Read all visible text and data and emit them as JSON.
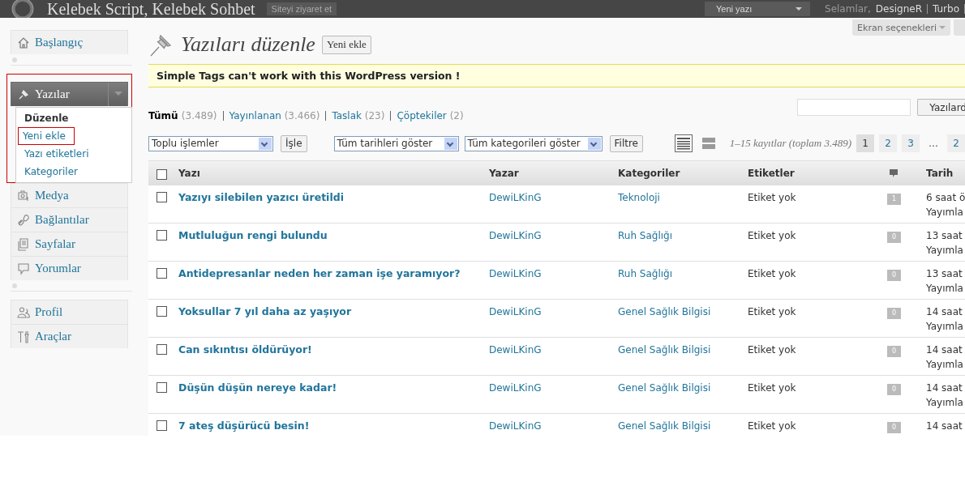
{
  "topbar": {
    "site_title": "Kelebek Script, Kelebek Sohbet",
    "visit_button": "Siteyi ziyaret et",
    "new_post_dropdown": "Yeni yazı",
    "greeting": "Selamlar,",
    "user": "DesigneR",
    "links": [
      "Turbo"
    ]
  },
  "screen_tabs": [
    "Ekran seçenekleri"
  ],
  "sidebar": {
    "groups": [
      [
        {
          "label": "Başlangıç",
          "kind": "home",
          "expanded": false,
          "outlined": false
        }
      ],
      [
        {
          "label": "Yazılar",
          "kind": "pin",
          "expanded": true,
          "outlined": true,
          "submenu": [
            {
              "label": "Düzenle",
              "selected": true,
              "outlined": false
            },
            {
              "label": "Yeni ekle",
              "selected": false,
              "outlined": true
            },
            {
              "label": "Yazı etiketleri",
              "selected": false,
              "outlined": false
            },
            {
              "label": "Kategoriler",
              "selected": false,
              "outlined": false
            }
          ]
        },
        {
          "label": "Medya",
          "kind": "media",
          "expanded": false,
          "outlined": false
        },
        {
          "label": "Bağlantılar",
          "kind": "link",
          "expanded": false,
          "outlined": false
        },
        {
          "label": "Sayfalar",
          "kind": "pages",
          "expanded": false,
          "outlined": false
        },
        {
          "label": "Yorumlar",
          "kind": "comments",
          "expanded": false,
          "outlined": false
        }
      ],
      [
        {
          "label": "Profil",
          "kind": "users",
          "expanded": false,
          "outlined": false
        },
        {
          "label": "Araçlar",
          "kind": "tools",
          "expanded": false,
          "outlined": false
        }
      ]
    ]
  },
  "page_title": "Yazıları düzenle",
  "add_button": "Yeni ekle",
  "notice": "Simple Tags can't work with this WordPress version !",
  "status_filters": [
    {
      "label": "Tümü",
      "count": "(3.489)",
      "selected": true
    },
    {
      "label": "Yayınlanan",
      "count": "(3.466)",
      "selected": false
    },
    {
      "label": "Taslak",
      "count": "(23)",
      "selected": false
    },
    {
      "label": "Çöptekiler",
      "count": "(2)",
      "selected": false
    }
  ],
  "search": {
    "button": "Yazılard"
  },
  "bulk_actions": {
    "select": "Toplu işlemler",
    "apply": "İşle"
  },
  "filters": {
    "dates": "Tüm tarihleri göster",
    "categories": "Tüm kategorileri göster",
    "button": "Filtre"
  },
  "view_modes": [
    {
      "kind": "list",
      "selected": true
    },
    {
      "kind": "excerpt",
      "selected": false
    }
  ],
  "displaying": "1–15 kayıtlar (toplam 3.489)",
  "pages": {
    "gap": "…",
    "items": [
      {
        "label": "1",
        "selected": true
      },
      {
        "label": "2",
        "selected": false
      },
      {
        "label": "3",
        "selected": false
      },
      {
        "label": "2",
        "selected": false
      }
    ]
  },
  "table": {
    "select_all_checked": false,
    "columns": [
      "Yazı",
      "Yazar",
      "Kategoriler",
      "Etiketler",
      "Tarih"
    ],
    "rows": [
      {
        "checked": false,
        "title": "Yazıyı silebilen yazıcı üretildi",
        "author": "DewiLKinG",
        "category": "Teknoloji",
        "tags": "Etiket yok",
        "comments": "1",
        "date": "6 saat ö",
        "status": "Yayımla"
      },
      {
        "checked": false,
        "title": "Mutluluğun rengi bulundu",
        "author": "DewiLKinG",
        "category": "Ruh Sağlığı",
        "tags": "Etiket yok",
        "comments": "0",
        "date": "13 saat",
        "status": "Yayımla"
      },
      {
        "checked": false,
        "title": "Antidepresanlar neden her zaman işe yaramıyor?",
        "author": "DewiLKinG",
        "category": "Ruh Sağlığı",
        "tags": "Etiket yok",
        "comments": "0",
        "date": "13 saat",
        "status": "Yayımla"
      },
      {
        "checked": false,
        "title": "Yoksullar 7 yıl daha az yaşıyor",
        "author": "DewiLKinG",
        "category": "Genel Sağlık Bilgisi",
        "tags": "Etiket yok",
        "comments": "0",
        "date": "14 saat",
        "status": "Yayımla"
      },
      {
        "checked": false,
        "title": "Can sıkıntısı öldürüyor!",
        "author": "DewiLKinG",
        "category": "Genel Sağlık Bilgisi",
        "tags": "Etiket yok",
        "comments": "0",
        "date": "14 saat",
        "status": "Yayımla"
      },
      {
        "checked": false,
        "title": "Düşün düşün nereye kadar!",
        "author": "DewiLKinG",
        "category": "Genel Sağlık Bilgisi",
        "tags": "Etiket yok",
        "comments": "0",
        "date": "14 saat",
        "status": "Yayımla"
      },
      {
        "checked": false,
        "title": "7 ateş düşürücü besin!",
        "author": "DewiLKinG",
        "category": "Genel Sağlık Bilgisi",
        "tags": "Etiket yok",
        "comments": "0",
        "date": "14 saat"
      }
    ]
  }
}
